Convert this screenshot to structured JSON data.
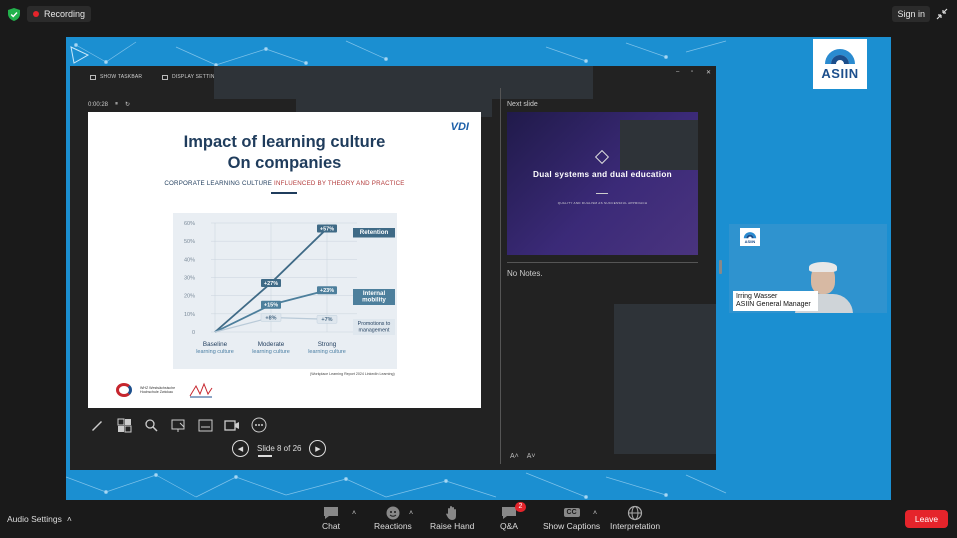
{
  "topbar": {
    "recording_label": "Recording",
    "signin_label": "Sign in"
  },
  "share": {
    "logo_text": "ASIIN"
  },
  "presenter": {
    "show_taskbar": "SHOW TASKBAR",
    "display_settings": "DISPLAY SETTINGS",
    "timer": "0:00:28",
    "next_slide_label": "Next slide",
    "next_slide_title": "Dual systems and dual education",
    "next_slide_subtitle": "QUALITY AND DUALISM AS SUCCESSFUL APPROACH",
    "notes": "No Notes.",
    "slide_counter": "Slide 8 of 26"
  },
  "slide": {
    "title_line1": "Impact of learning culture",
    "title_line2": "On companies",
    "vdi": "VDI",
    "subtitle_a": "CORPORATE LEARNING CULTURE ",
    "subtitle_b": "INFLUENCED BY THEORY AND PRACTICE",
    "source": "(Workplace Learning Report 2024 LinkedIn Learning)",
    "whz_text": "WHZ Westsächsische Hochschule Zwickau"
  },
  "chart_data": {
    "type": "line",
    "categories": [
      "Baseline\nlearning culture",
      "Moderate\nlearning culture",
      "Strong\nlearning culture"
    ],
    "category_lines": [
      [
        "Baseline",
        "learning culture"
      ],
      [
        "Moderate",
        "learning culture"
      ],
      [
        "Strong",
        "learning culture"
      ]
    ],
    "ylim": [
      0,
      60
    ],
    "yticks": [
      "0",
      "10%",
      "20%",
      "30%",
      "40%",
      "50%",
      "60%"
    ],
    "series": [
      {
        "name": "Retention",
        "values": [
          0,
          27,
          57
        ],
        "labels": [
          "",
          "+27%",
          "+57%"
        ],
        "color": "#3f6a86"
      },
      {
        "name": "Internal\nmobility",
        "name_lines": [
          "Internal",
          "mobility"
        ],
        "values": [
          0,
          15,
          23
        ],
        "labels": [
          "",
          "+15%",
          "+23%"
        ],
        "color": "#4d7f9c"
      },
      {
        "name": "Promotions to\nmanagement",
        "name_lines": [
          "Promotions to",
          "management"
        ],
        "values": [
          0,
          8,
          7
        ],
        "labels": [
          "",
          "+8%",
          "+7%"
        ],
        "color": "#b9cad8"
      }
    ],
    "grid": true
  },
  "video": {
    "logo_text": "ASIIN",
    "name": "Irring Wasser",
    "role": "ASIIN General Manager"
  },
  "bottombar": {
    "audio_settings": "Audio Settings",
    "chat": "Chat",
    "reactions": "Reactions",
    "raise_hand": "Raise Hand",
    "qa": "Q&A",
    "qa_badge": "2",
    "show_captions": "Show Captions",
    "captions_icon_text": "CC",
    "interpretation": "Interpretation",
    "leave": "Leave"
  }
}
